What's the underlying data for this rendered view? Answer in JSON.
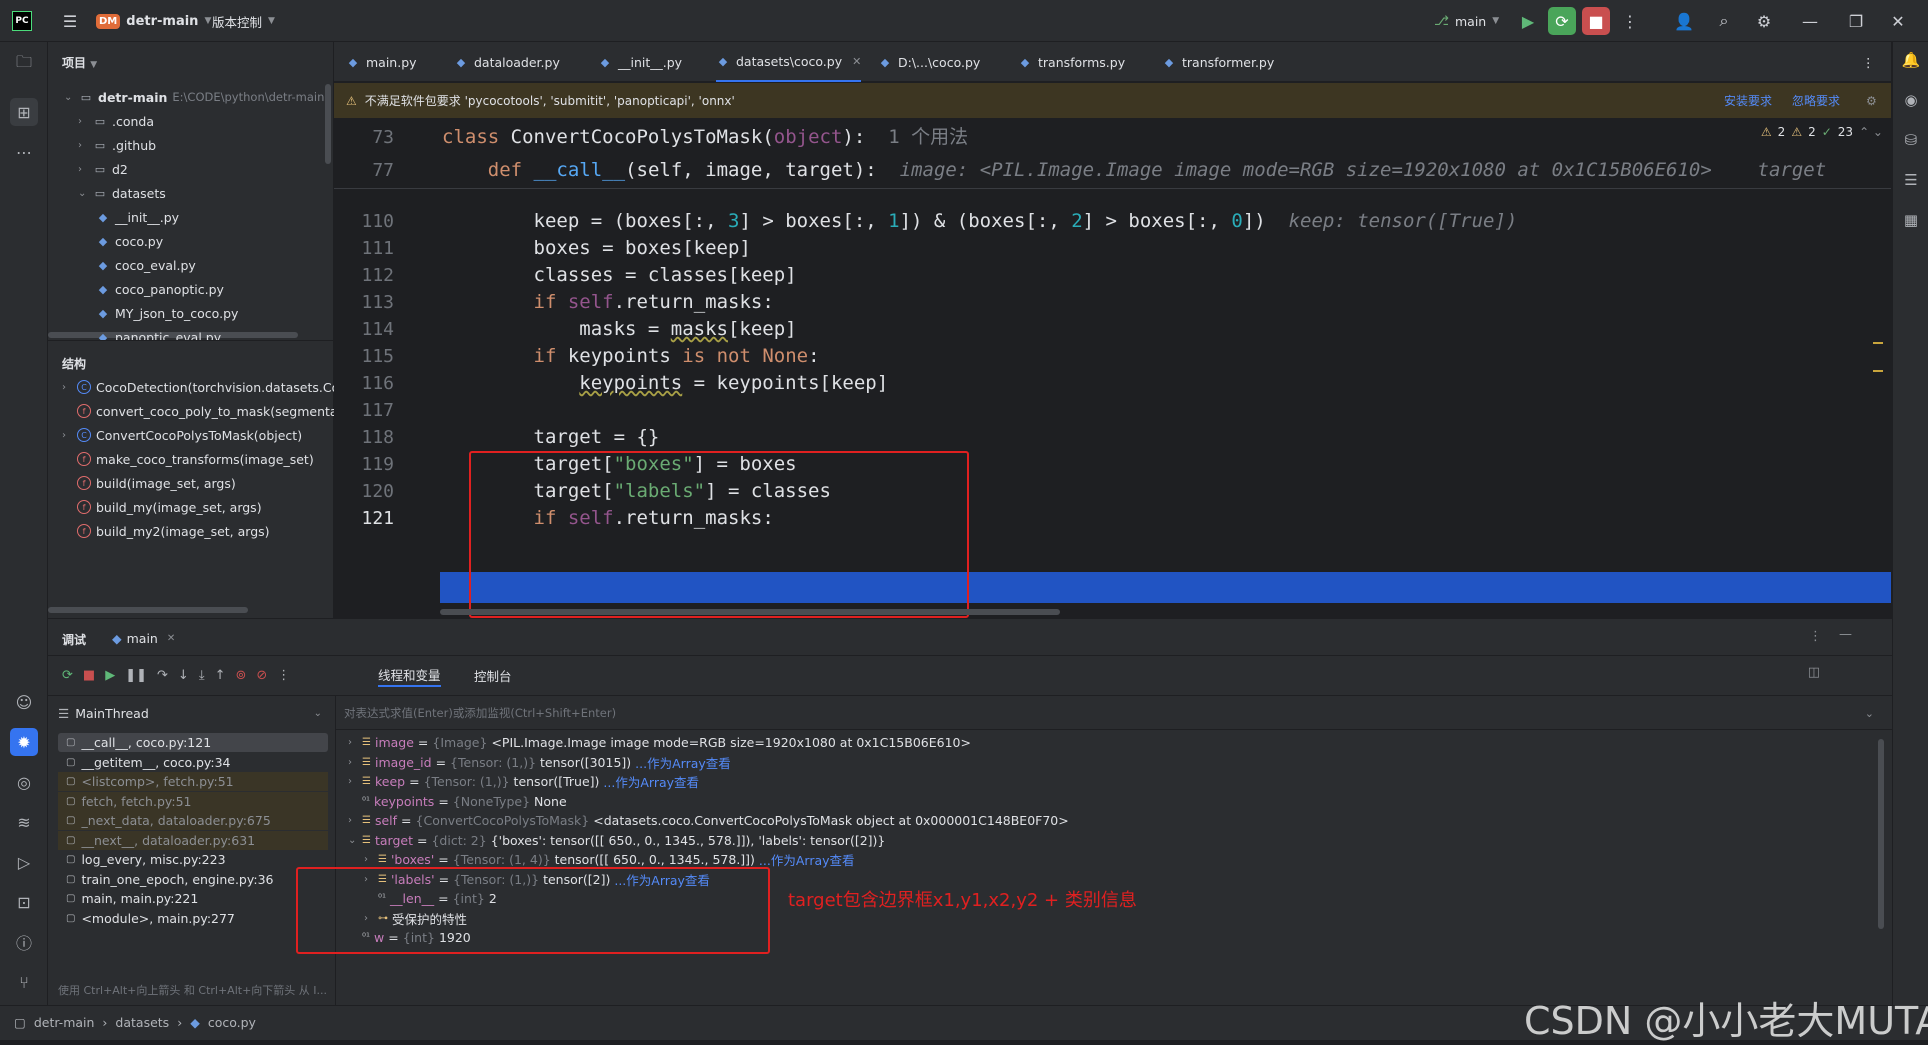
{
  "titlebar": {
    "project_badge": "DM",
    "project_name": "detr-main",
    "vcs_menu": "版本控制",
    "branch": "main"
  },
  "project_panel": {
    "title": "项目",
    "root": {
      "name": "detr-main",
      "path": "E:\\CODE\\python\\detr-main"
    },
    "items": [
      ".conda",
      ".github",
      "d2",
      "datasets",
      "__init__.py",
      "coco.py",
      "coco_eval.py",
      "coco_panoptic.py",
      "MY_json_to_coco.py",
      "panoptic_eval.py"
    ]
  },
  "structure_panel": {
    "title": "结构",
    "items": [
      "CocoDetection(torchvision.datasets.Coco",
      "convert_coco_poly_to_mask(segmentatic",
      "ConvertCocoPolysToMask(object)",
      "make_coco_transforms(image_set)",
      "build(image_set, args)",
      "build_my(image_set, args)",
      "build_my2(image_set, args)"
    ]
  },
  "tabs": [
    "main.py",
    "dataloader.py",
    "__init__.py",
    "datasets\\coco.py",
    "D:\\...\\coco.py",
    "transforms.py",
    "transformer.py"
  ],
  "warning": {
    "text": "不满足软件包要求 'pycocotools', 'submitit', 'panopticapi', 'onnx'",
    "install": "安装要求",
    "ignore": "忽略要求"
  },
  "inspections": {
    "warn1": "2",
    "warn2": "2",
    "ok": "23"
  },
  "code": {
    "sticky": [
      {
        "ln": "73",
        "kw": "class",
        "name": "ConvertCocoPolysToMask",
        "arg": "object",
        "hint": "1 个用法"
      },
      {
        "ln": "77",
        "kw": "def",
        "name": "__call__",
        "sig": "self, image, target",
        "hint": "image: <PIL.Image.Image image mode=RGB size=1920x1080 at 0x1C15B06E610>    target"
      }
    ],
    "ln": [
      "110",
      "111",
      "112",
      "113",
      "114",
      "115",
      "116",
      "117",
      "118",
      "119",
      "120",
      "121"
    ],
    "keep_hint": "keep: tensor([True])"
  },
  "debug": {
    "title": "调试",
    "session": "main",
    "tab_threads": "线程和变量",
    "tab_console": "控制台",
    "thread": "MainThread",
    "eval_placeholder": "对表达式求值(Enter)或添加监视(Ctrl+Shift+Enter)",
    "frames": [
      "__call__, coco.py:121",
      "__getitem__, coco.py:34",
      "<listcomp>, fetch.py:51",
      "fetch, fetch.py:51",
      "_next_data, dataloader.py:675",
      "__next__, dataloader.py:631",
      "log_every, misc.py:223",
      "train_one_epoch, engine.py:36",
      "main, main.py:221",
      "<module>, main.py:277"
    ],
    "frames_hint": "使用 Ctrl+Alt+向上箭头 和 Ctrl+Alt+向下箭头 从 I...",
    "vars": [
      {
        "name": "image",
        "type": "{Image}",
        "value": "<PIL.Image.Image image mode=RGB size=1920x1080 at 0x1C15B06E610>",
        "link": ""
      },
      {
        "name": "image_id",
        "type": "{Tensor: (1,)}",
        "value": "tensor([3015])",
        "link": "...作为Array查看"
      },
      {
        "name": "keep",
        "type": "{Tensor: (1,)}",
        "value": "tensor([True])",
        "link": "...作为Array查看"
      },
      {
        "name": "keypoints",
        "type": "{NoneType}",
        "value": "None",
        "link": ""
      },
      {
        "name": "self",
        "type": "{ConvertCocoPolysToMask}",
        "value": "<datasets.coco.ConvertCocoPolysToMask object at 0x000001C148BE0F70>",
        "link": ""
      },
      {
        "name": "target",
        "type": "{dict: 2}",
        "value": "{'boxes': tensor([[ 650.,    0., 1345.,  578.]]), 'labels': tensor([2])}",
        "link": ""
      },
      {
        "name": "'boxes'",
        "type": "{Tensor: (1, 4)}",
        "value": "tensor([[ 650.,    0., 1345.,  578.]])",
        "link": "...作为Array查看"
      },
      {
        "name": "'labels'",
        "type": "{Tensor: (1,)}",
        "value": "tensor([2])",
        "link": "...作为Array查看"
      },
      {
        "name": "__len__",
        "type": "{int}",
        "value": "2",
        "link": ""
      },
      {
        "name": "受保护的特性",
        "type": "",
        "value": "",
        "link": ""
      },
      {
        "name": "w",
        "type": "{int}",
        "value": "1920",
        "link": ""
      }
    ]
  },
  "annotation": "target包含边界框x1,y1,x2,y2 + 类别信息",
  "statusbar": {
    "crumbs": [
      "detr-main",
      "datasets",
      "coco.py"
    ],
    "watermark": "CSDN @小小老大MUTA"
  }
}
